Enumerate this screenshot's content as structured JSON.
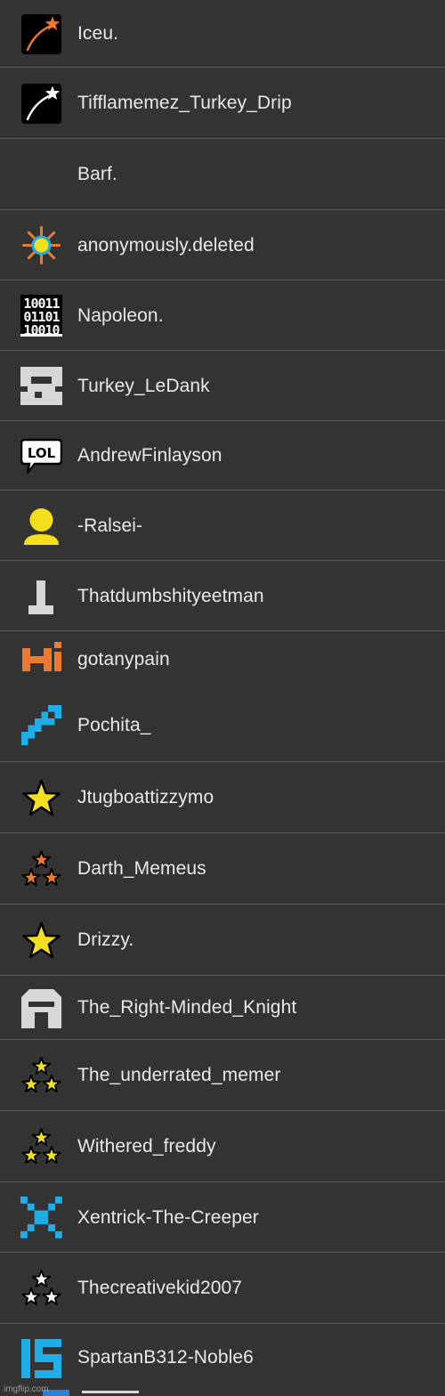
{
  "users": [
    {
      "name": "Iceu.",
      "icon": "orange-shooting-star-icon"
    },
    {
      "name": "Tifflamemez_Turkey_Drip",
      "icon": "white-shooting-star-icon"
    },
    {
      "name": "Barf.",
      "icon": "none"
    },
    {
      "name": "anonymously.deleted",
      "icon": "sun-icon"
    },
    {
      "name": "Napoleon.",
      "icon": "binary-code-icon"
    },
    {
      "name": "Turkey_LeDank",
      "icon": "gray-block-face-icon"
    },
    {
      "name": "AndrewFinlayson",
      "icon": "lol-speech-bubble-icon",
      "icon_text": "LOL"
    },
    {
      "name": "-Ralsei-",
      "icon": "yellow-person-icon"
    },
    {
      "name": "Thatdumbshityeetman",
      "icon": "gray-pillar-icon"
    },
    {
      "name": "gotanypain",
      "icon": "orange-hi-icon"
    },
    {
      "name": "Pochita_",
      "icon": "blue-pixel-diagonal-icon"
    },
    {
      "name": "Jtugboattizzymo",
      "icon": "yellow-star-icon"
    },
    {
      "name": "Darth_Memeus",
      "icon": "three-orange-stars-icon"
    },
    {
      "name": "Drizzy.",
      "icon": "yellow-star-icon"
    },
    {
      "name": "The_Right-Minded_Knight",
      "icon": "knight-helmet-icon"
    },
    {
      "name": "The_underrated_memer",
      "icon": "three-yellow-stars-icon"
    },
    {
      "name": "Withered_freddy",
      "icon": "three-yellow-stars-icon"
    },
    {
      "name": "Xentrick-The-Creeper",
      "icon": "blue-pixel-x-icon"
    },
    {
      "name": "Thecreativekid2007",
      "icon": "three-white-stars-icon"
    },
    {
      "name": "SpartanB312-Noble6",
      "icon": "blue-15-icon"
    }
  ],
  "watermark": "imgflip.com",
  "colors": {
    "background": "#333333",
    "divider": "#5c5c5c",
    "text": "#e9e9e9",
    "orange": "#f07a2c",
    "yellow": "#f3df1b",
    "blue": "#1eaee8"
  }
}
